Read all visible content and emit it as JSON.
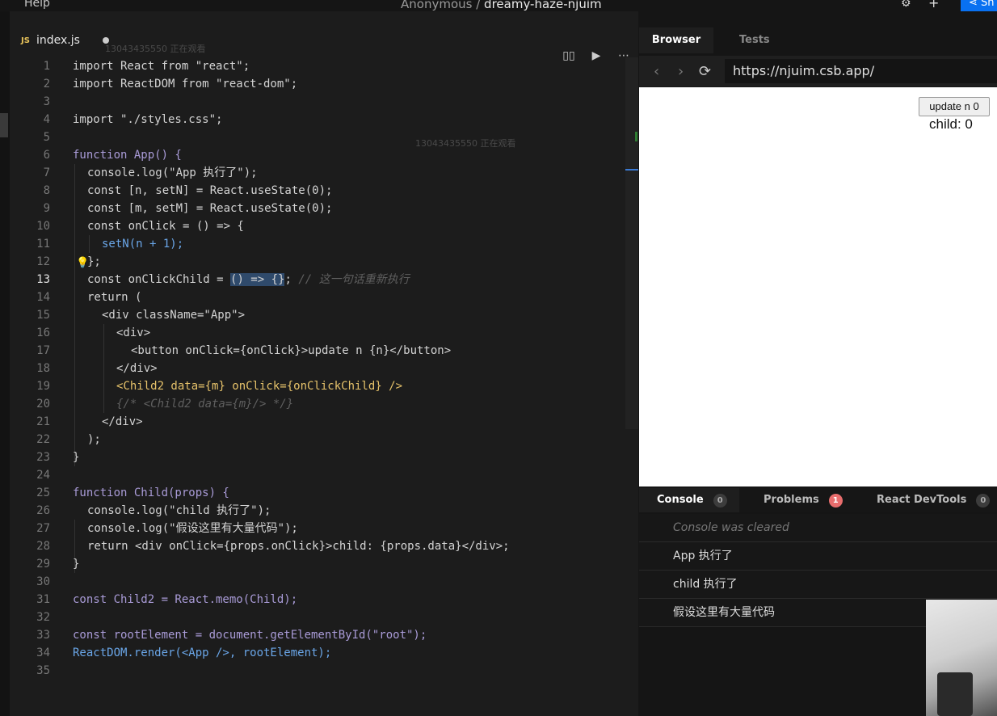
{
  "topbar": {
    "help": "Help",
    "owner": "Anonymous /",
    "project": "dreamy-haze-njuim",
    "share": "Sh"
  },
  "editor": {
    "tab_lang": "JS",
    "tab_name": "index.js",
    "watching_1": "13043435550 正在观看",
    "watching_2": "13043435550 正在观看"
  },
  "code_lines": [
    "1",
    "2",
    "3",
    "4",
    "5",
    "6",
    "7",
    "8",
    "9",
    "10",
    "11",
    "12",
    "13",
    "14",
    "15",
    "16",
    "17",
    "18",
    "19",
    "20",
    "21",
    "22",
    "23",
    "24",
    "25",
    "26",
    "27",
    "28",
    "29",
    "30",
    "31",
    "32",
    "33",
    "34",
    "35"
  ],
  "code": {
    "l1": "import React from \"react\";",
    "l2": "import ReactDOM from \"react-dom\";",
    "l4": "import \"./styles.css\";",
    "l6": "function App() {",
    "l7": "console.log(\"App 执行了\");",
    "l8": "const [n, setN] = React.useState(0);",
    "l9": "const [m, setM] = React.useState(0);",
    "l10": "const onClick = () => {",
    "l11": "setN(n + 1);",
    "l12": "};",
    "l13_a": "const onClickChild = ",
    "l13_b": "() => {}",
    "l13_c": "; ",
    "l13_cmt": "// 这一句话重新执行",
    "l14": "return (",
    "l15": "<div className=\"App\">",
    "l16": "<div>",
    "l17": "<button onClick={onClick}>update n {n}</button>",
    "l18": "</div>",
    "l19": "<Child2 data={m} onClick={onClickChild} />",
    "l20": "{/* <Child2 data={m}/> */}",
    "l21": "</div>",
    "l22": ");",
    "l23": "}",
    "l25": "function Child(props) {",
    "l26": "console.log(\"child 执行了\");",
    "l27": "console.log(\"假设这里有大量代码\");",
    "l28": "return <div onClick={props.onClick}>child: {props.data}</div>;",
    "l29": "}",
    "l31": "const Child2 = React.memo(Child);",
    "l33": "const rootElement = document.getElementById(\"root\");",
    "l34": "ReactDOM.render(<App />, rootElement);"
  },
  "browser": {
    "tab_browser": "Browser",
    "tab_tests": "Tests",
    "url": "https://njuim.csb.app/",
    "button_label": "update n 0",
    "child_text": "child: 0"
  },
  "console": {
    "tab_console": "Console",
    "console_count": "0",
    "tab_problems": "Problems",
    "problems_count": "1",
    "tab_devtools": "React DevTools",
    "devtools_count": "0",
    "rows": [
      "Console was cleared",
      "App 执行了",
      "child 执行了",
      "假设这里有大量代码"
    ]
  }
}
